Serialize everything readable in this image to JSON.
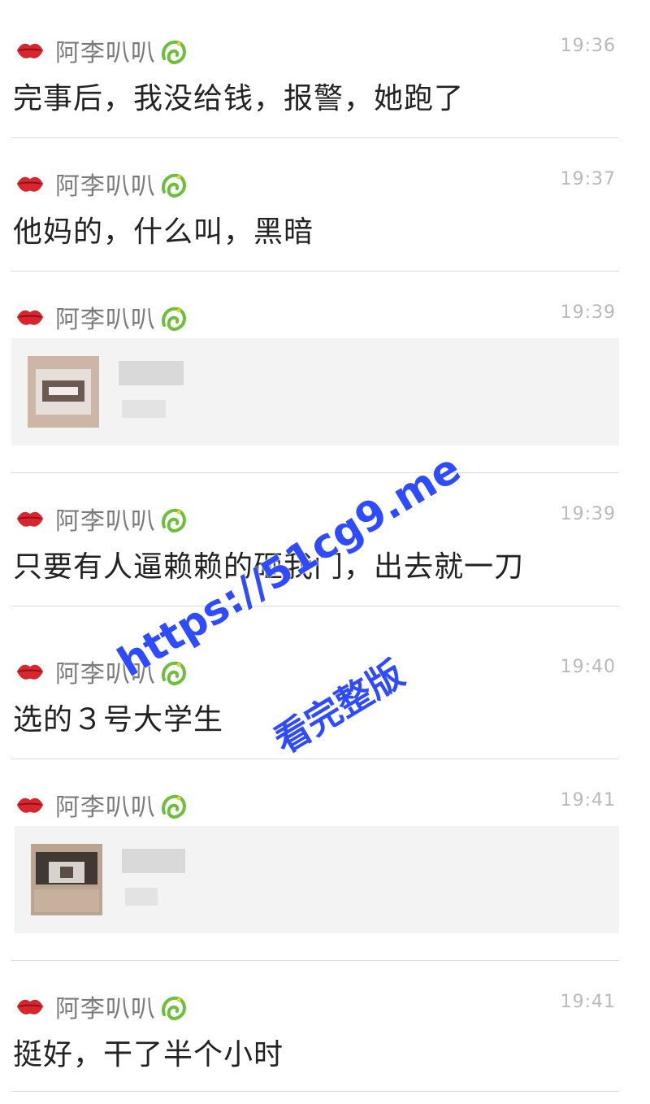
{
  "messages": [
    {
      "sender": "阿李叭叭",
      "time": "19:36",
      "text": "完事后，我没给钱，报警，她跑了"
    },
    {
      "sender": "阿李叭叭",
      "time": "19:37",
      "text": "他妈的，什么叫，黑暗"
    },
    {
      "sender": "阿李叭叭",
      "time": "19:39",
      "text": ""
    },
    {
      "sender": "阿李叭叭",
      "time": "19:39",
      "text": "只要有人逼赖赖的砸我门，出去就一刀"
    },
    {
      "sender": "阿李叭叭",
      "time": "19:40",
      "text": "选的３号大学生"
    },
    {
      "sender": "阿李叭叭",
      "time": "19:41",
      "text": ""
    },
    {
      "sender": "阿李叭叭",
      "time": "19:41",
      "text": "挺好，干了半个小时"
    }
  ],
  "icons": {
    "sender_badge": "lips-icon",
    "name_suffix": "dragon-icon"
  },
  "watermark": {
    "line1": "https://51cg9.me",
    "line2": "看完整版"
  },
  "colors": {
    "watermark": "#2f4bff",
    "divider": "#dcdcdc",
    "time": "#b9b9b9",
    "name": "#7b7b7b",
    "lips": "#d7262e",
    "dragon": "#6cbf3a"
  }
}
